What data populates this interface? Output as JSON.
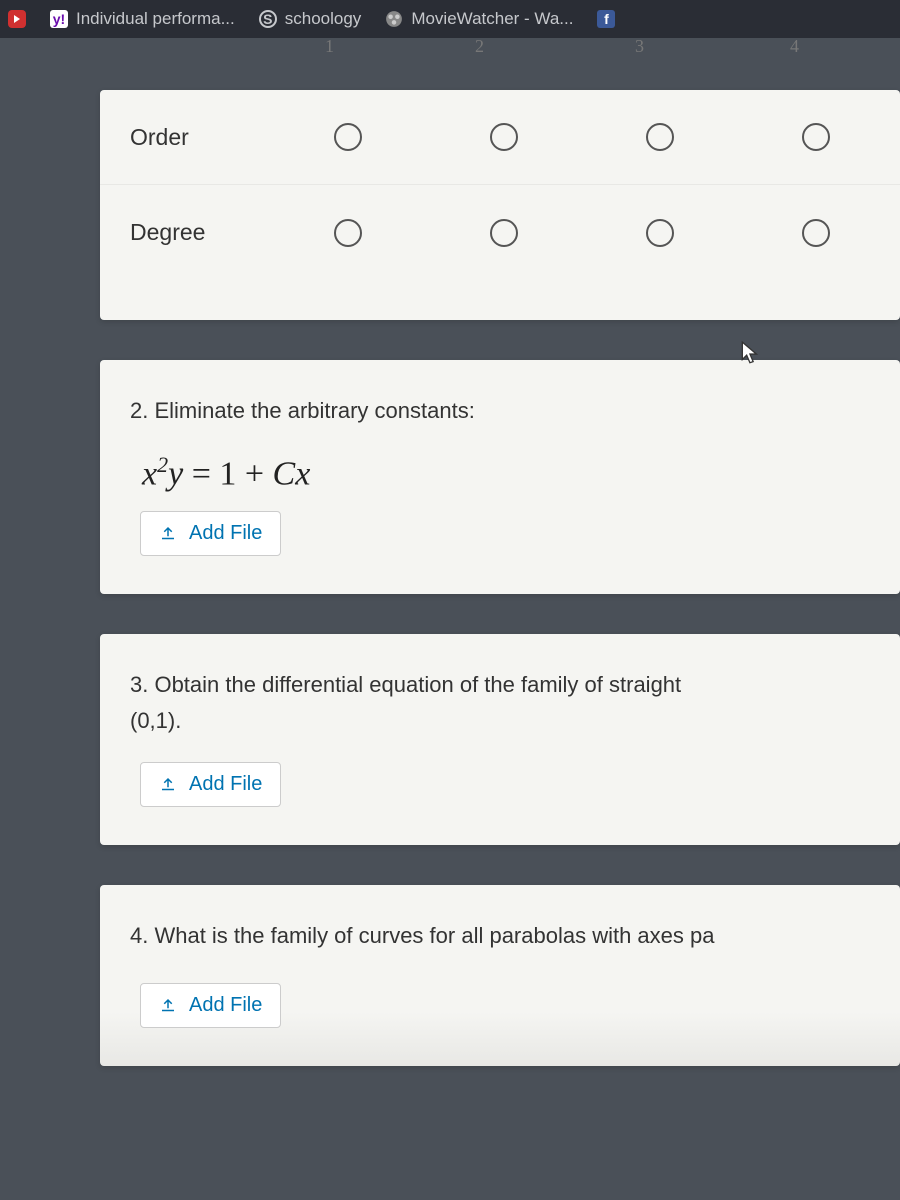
{
  "tabs": [
    {
      "icon": "y!",
      "label": "Individual performa..."
    },
    {
      "icon": "S",
      "label": "schoology"
    },
    {
      "icon": "movie",
      "label": "MovieWatcher - Wa..."
    },
    {
      "icon": "f",
      "label": ""
    }
  ],
  "header_numbers": [
    "1",
    "2",
    "3",
    "4"
  ],
  "grid": {
    "rows": [
      {
        "label": "Order"
      },
      {
        "label": "Degree"
      }
    ],
    "cols": 4
  },
  "questions": {
    "q2": {
      "title": "2. Eliminate the arbitrary constants:",
      "equation_parts": {
        "lhs_x": "x",
        "lhs_sup": "2",
        "lhs_y": "y",
        "eq": " = 1 + ",
        "c": "C",
        "rhs_x": "x"
      },
      "add_file": "Add File"
    },
    "q3": {
      "title": "3. Obtain the differential equation of the family of straight",
      "point": "(0,1).",
      "add_file": "Add File"
    },
    "q4": {
      "title": "4. What is the family of curves for all parabolas with axes pa",
      "add_file": "Add File"
    }
  }
}
